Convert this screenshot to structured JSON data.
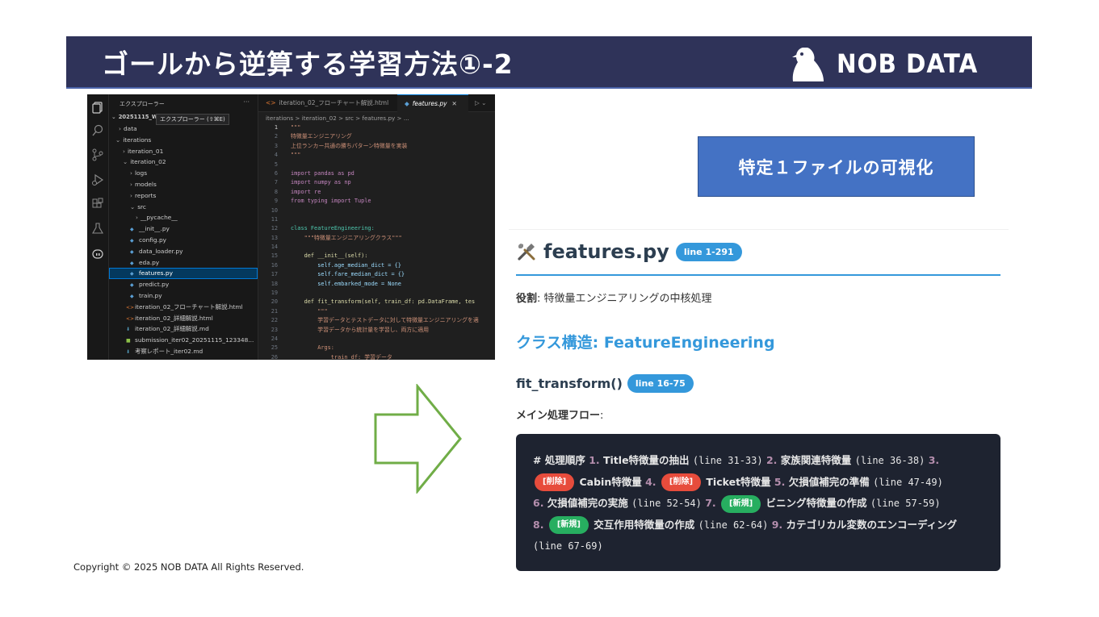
{
  "header": {
    "title": "ゴールから逆算する学習方法①-2",
    "logo_text": "NOB DATA"
  },
  "vscode": {
    "explorer_title": "エクスプローラー",
    "explorer_more": "···",
    "tooltip": "エクスプローラー (⇧⌘E)",
    "root_folder": "20251115_W",
    "tree": [
      {
        "label": "data",
        "kind": "folder",
        "indent": 12,
        "open": false
      },
      {
        "label": "iterations",
        "kind": "folder",
        "indent": 8,
        "open": true
      },
      {
        "label": "iteration_01",
        "kind": "folder",
        "indent": 17,
        "open": false
      },
      {
        "label": "iteration_02",
        "kind": "folder",
        "indent": 17,
        "open": true
      },
      {
        "label": "logs",
        "kind": "folder",
        "indent": 26,
        "open": false
      },
      {
        "label": "models",
        "kind": "folder",
        "indent": 26,
        "open": false
      },
      {
        "label": "reports",
        "kind": "folder",
        "indent": 26,
        "open": false
      },
      {
        "label": "src",
        "kind": "folder",
        "indent": 26,
        "open": true
      },
      {
        "label": "__pycache__",
        "kind": "folder",
        "indent": 33,
        "open": false
      },
      {
        "label": "__init__.py",
        "kind": "py",
        "indent": 26
      },
      {
        "label": "config.py",
        "kind": "py",
        "indent": 26
      },
      {
        "label": "data_loader.py",
        "kind": "py",
        "indent": 26
      },
      {
        "label": "eda.py",
        "kind": "py",
        "indent": 26
      },
      {
        "label": "features.py",
        "kind": "py",
        "indent": 26,
        "selected": true
      },
      {
        "label": "predict.py",
        "kind": "py",
        "indent": 26
      },
      {
        "label": "train.py",
        "kind": "py",
        "indent": 26
      },
      {
        "label": "iteration_02_フローチャート解説.html",
        "kind": "html",
        "indent": 21
      },
      {
        "label": "iteration_02_詳細解説.html",
        "kind": "html",
        "indent": 21
      },
      {
        "label": "iteration_02_詳細解説.md",
        "kind": "md",
        "indent": 21
      },
      {
        "label": "submission_iter02_20251115_123348...",
        "kind": "csv",
        "indent": 21
      },
      {
        "label": "考察レポート_iter02.md",
        "kind": "md",
        "indent": 21
      }
    ],
    "tabs": [
      {
        "label": "iteration_02_フローチャート解説.html",
        "active": false
      },
      {
        "label": "features.py",
        "active": true
      }
    ],
    "breadcrumb": "iterations > iteration_02 > src > features.py > ...",
    "code_lines": [
      {
        "n": "1",
        "t": "\"\"\""
      },
      {
        "n": "2",
        "t": "特徴量エンジニアリング"
      },
      {
        "n": "3",
        "t": "上位ランカー共通の勝ちパターン特徴量を実装"
      },
      {
        "n": "4",
        "t": "\"\"\""
      },
      {
        "n": "5",
        "t": ""
      },
      {
        "n": "6",
        "t": "import pandas as pd"
      },
      {
        "n": "7",
        "t": "import numpy as np"
      },
      {
        "n": "8",
        "t": "import re"
      },
      {
        "n": "9",
        "t": "from typing import Tuple"
      },
      {
        "n": "10",
        "t": ""
      },
      {
        "n": "11",
        "t": ""
      },
      {
        "n": "12",
        "t": "class FeatureEngineering:"
      },
      {
        "n": "13",
        "t": "    \"\"\"特徴量エンジニアリングクラス\"\"\""
      },
      {
        "n": "14",
        "t": ""
      },
      {
        "n": "15",
        "t": "    def __init__(self):"
      },
      {
        "n": "16",
        "t": "        self.age_median_dict = {}"
      },
      {
        "n": "17",
        "t": "        self.fare_median_dict = {}"
      },
      {
        "n": "18",
        "t": "        self.embarked_mode = None"
      },
      {
        "n": "19",
        "t": ""
      },
      {
        "n": "20",
        "t": "    def fit_transform(self, train_df: pd.DataFrame, tes"
      },
      {
        "n": "21",
        "t": "        \"\"\""
      },
      {
        "n": "22",
        "t": "        学習データとテストデータに対して特徴量エンジニアリングを適"
      },
      {
        "n": "23",
        "t": "        学習データから統計量を学習し、両方に適用"
      },
      {
        "n": "24",
        "t": ""
      },
      {
        "n": "25",
        "t": "        Args:"
      },
      {
        "n": "26",
        "t": "            train_df: 学習データ"
      }
    ]
  },
  "viz_box": {
    "label": "特定１ファイルの可視化"
  },
  "doc": {
    "title": "features.py",
    "title_badge": "line 1-291",
    "role_label": "役割",
    "role_text": ": 特徴量エンジニアリングの中核処理",
    "class_heading": "クラス構造: FeatureEngineering",
    "method_title": "fit_transform()",
    "method_badge": "line 16-75",
    "flow_label": "メイン処理フロー",
    "flow_colon": ":",
    "flow": {
      "prefix": "# 処理順序 ",
      "s1_num": "1.",
      "s1_a": " Title特徴量の抽出 ",
      "s1_b": "(line 31-33)",
      "s2_num": " 2.",
      "s2_a": " 家族関連特徴量 ",
      "s2_b": "(line 36-38)",
      "s3_num": " 3.",
      "s3_tag": "[削除]",
      "s3_a": " Cabin特徴量",
      "s4_num": " 4.",
      "s4_tag": "[削除]",
      "s4_a": " Ticket特徴量",
      "s5_num": " 5.",
      "s5_a": " 欠損値補完の準備 ",
      "s5_b": "(line 47-49)",
      "s6_num": "6.",
      "s6_a": " 欠損値補完の実施 ",
      "s6_b": "(line 52-54)",
      "s7_num": " 7.",
      "s7_tag": "[新規]",
      "s7_a": " ビニング特徴量の作成 ",
      "s7_b": "(line 57-59)",
      "s8_num": "8.",
      "s8_tag": "[新規]",
      "s8_a": " 交互作用特徴量の作成 ",
      "s8_b": "(line 62-64)",
      "s9_num": " 9.",
      "s9_a": " カテゴリカル変数のエンコーディング ",
      "s9_b": "(line 67-69)"
    }
  },
  "footer": {
    "copyright": "Copyright © 2025 NOB DATA All Rights Reserved."
  },
  "colors": {
    "header_bg": "#2f3359",
    "accent_blue": "#3498db",
    "box_blue": "#4472c4",
    "arrow_green": "#70ad47",
    "tag_delete": "#e74c3c",
    "tag_new": "#27ae60"
  }
}
